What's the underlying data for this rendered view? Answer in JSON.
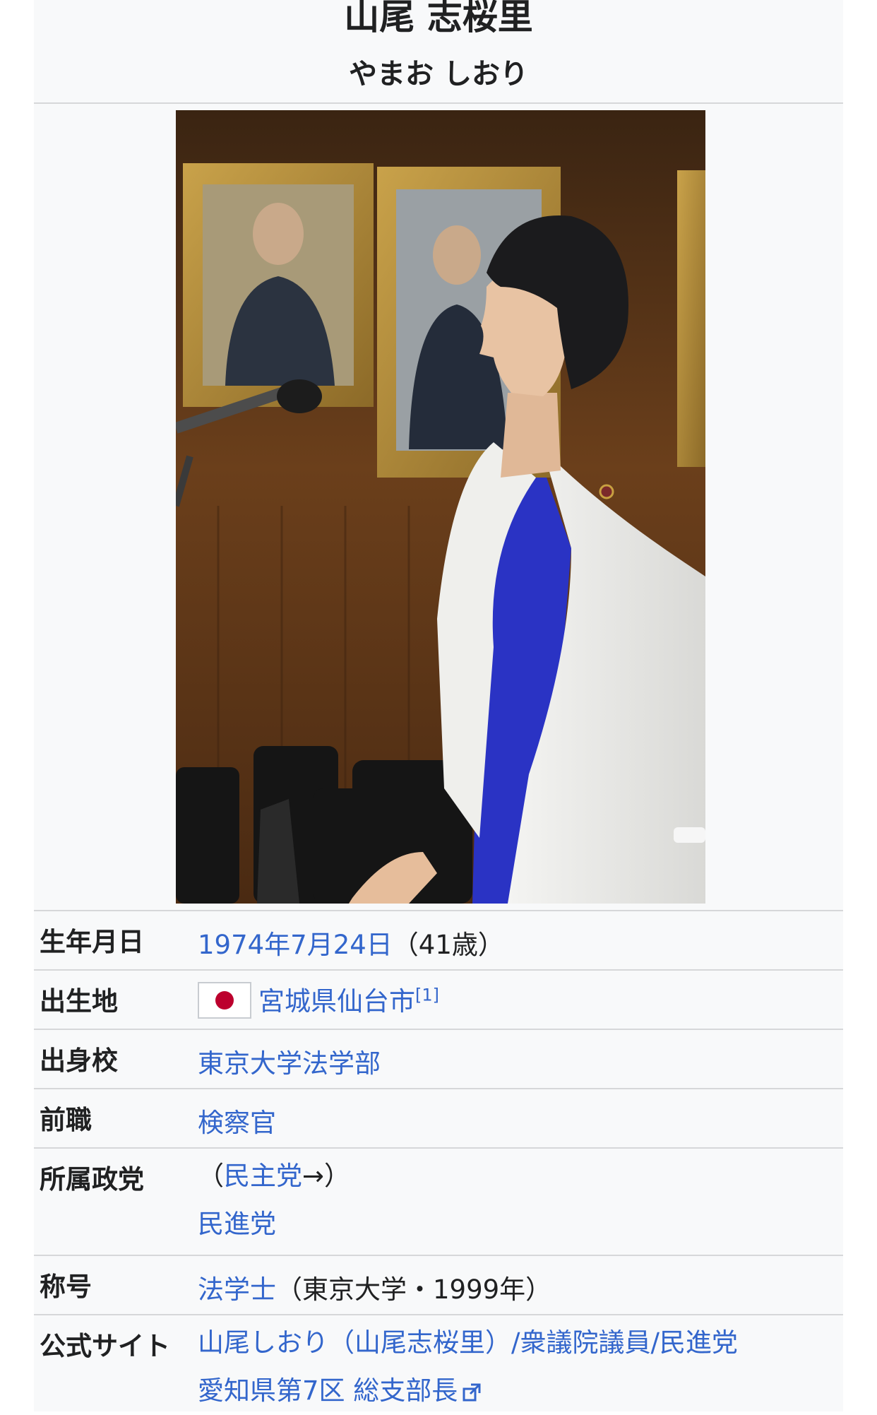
{
  "infobox": {
    "name": "山尾 志桜里",
    "name_kana": "やまお しおり",
    "photo": {
      "subject": "woman-in-white-jacket-at-microphone"
    },
    "rows": [
      {
        "label": "生年月日",
        "value_link": "1974年7月24日",
        "value_suffix": "（41歳）"
      },
      {
        "label": "出生地",
        "flag": "japan-flag-icon",
        "value_link": "宮城県仙台市",
        "ref": "[1]"
      },
      {
        "label": "出身校",
        "value_link": "東京大学法学部"
      },
      {
        "label": "前職",
        "value_link": "検察官"
      },
      {
        "label": "所属政党",
        "value_prefix": "（",
        "value_link": "民主党",
        "value_suffix": "→）",
        "value_line2_link": "民進党"
      },
      {
        "label": "称号",
        "value_link": "法学士",
        "value_suffix": "（東京大学・1999年）"
      },
      {
        "label": "公式サイト",
        "value_link": "山尾しおり（山尾志桜里）/衆議院議員/民進党",
        "value_line2_link": "愛知県第7区 総支部長",
        "icon": "external-link-icon"
      }
    ]
  },
  "colors": {
    "link": "#3366cc",
    "text": "#202122",
    "background": "#f8f9fa",
    "border": "#d6d7d9"
  }
}
